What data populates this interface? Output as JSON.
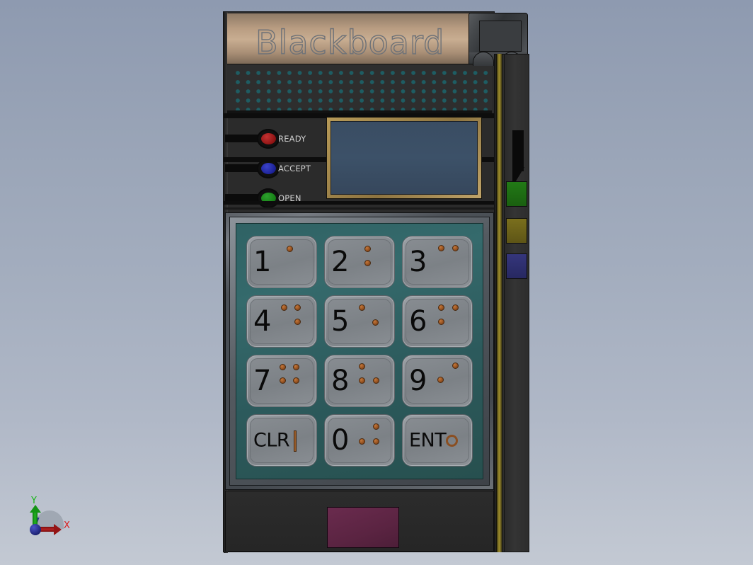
{
  "app": {
    "title": "Blackboard",
    "view_type": "3d-cad-render"
  },
  "device": {
    "brand_label": "Blackboard",
    "grille": {
      "name": "speaker-grille",
      "dot_color": "#1d6168",
      "rows": 5,
      "cols": 25
    },
    "indicators": [
      {
        "label": "READY",
        "color": "#8f1313",
        "state": "red-lamp"
      },
      {
        "label": "ACCEPT",
        "color": "#1b2196",
        "state": "blue-lamp"
      },
      {
        "label": "OPEN",
        "color": "#168016",
        "state": "green-lamp"
      }
    ],
    "display": {
      "name": "lcd-screen",
      "screen_color": "#3c5168",
      "bezel_color": "#a98c4f",
      "content": ""
    },
    "keypad": {
      "pad_color": "#316264",
      "keys": [
        {
          "label": "1",
          "type": "digit",
          "braille_dots": [
            [
              0,
              0
            ]
          ]
        },
        {
          "label": "2",
          "type": "digit",
          "braille_dots": [
            [
              0,
              0
            ],
            [
              1,
              0
            ]
          ]
        },
        {
          "label": "3",
          "type": "digit",
          "braille_dots": [
            [
              0,
              0
            ],
            [
              0,
              1
            ]
          ]
        },
        {
          "label": "4",
          "type": "digit",
          "braille_dots": [
            [
              0,
              0
            ],
            [
              0,
              1
            ],
            [
              1,
              1
            ]
          ]
        },
        {
          "label": "5",
          "type": "digit",
          "braille_dots": [
            [
              0,
              0
            ],
            [
              1,
              1
            ]
          ]
        },
        {
          "label": "6",
          "type": "digit",
          "braille_dots": [
            [
              0,
              0
            ],
            [
              0,
              1
            ],
            [
              1,
              0
            ]
          ]
        },
        {
          "label": "7",
          "type": "digit",
          "braille_dots": [
            [
              0,
              0
            ],
            [
              0,
              1
            ],
            [
              1,
              0
            ],
            [
              1,
              1
            ]
          ]
        },
        {
          "label": "8",
          "type": "digit",
          "braille_dots": [
            [
              0,
              0
            ],
            [
              1,
              0
            ],
            [
              1,
              1
            ]
          ]
        },
        {
          "label": "9",
          "type": "digit",
          "braille_dots": [
            [
              0,
              1
            ],
            [
              1,
              0
            ]
          ]
        },
        {
          "label": "CLR",
          "type": "function",
          "mark": "vertical-bar"
        },
        {
          "label": "0",
          "type": "digit",
          "braille_dots": [
            [
              0,
              1
            ],
            [
              1,
              0
            ],
            [
              1,
              1
            ]
          ]
        },
        {
          "label": "ENT",
          "type": "function",
          "mark": "ring"
        }
      ]
    },
    "bottom_slot": {
      "name": "card-slot",
      "color": "#5b2442"
    },
    "side_panel": {
      "arrow": "down-arrow",
      "blocks": [
        {
          "name": "indicator-block-green",
          "color": "#1d6b12"
        },
        {
          "name": "indicator-block-olive",
          "color": "#6b6119"
        },
        {
          "name": "indicator-block-blue",
          "color": "#2e2f6e"
        }
      ],
      "strip_color": "#9c8c2c"
    }
  },
  "axis_triad": {
    "x_label": "X",
    "y_label": "Y",
    "x_color": "#d92020",
    "y_color": "#16b516",
    "z_color": "#2a3090"
  },
  "background": {
    "top_color": "#8e9ab0",
    "bottom_color": "#c3c9d3"
  }
}
